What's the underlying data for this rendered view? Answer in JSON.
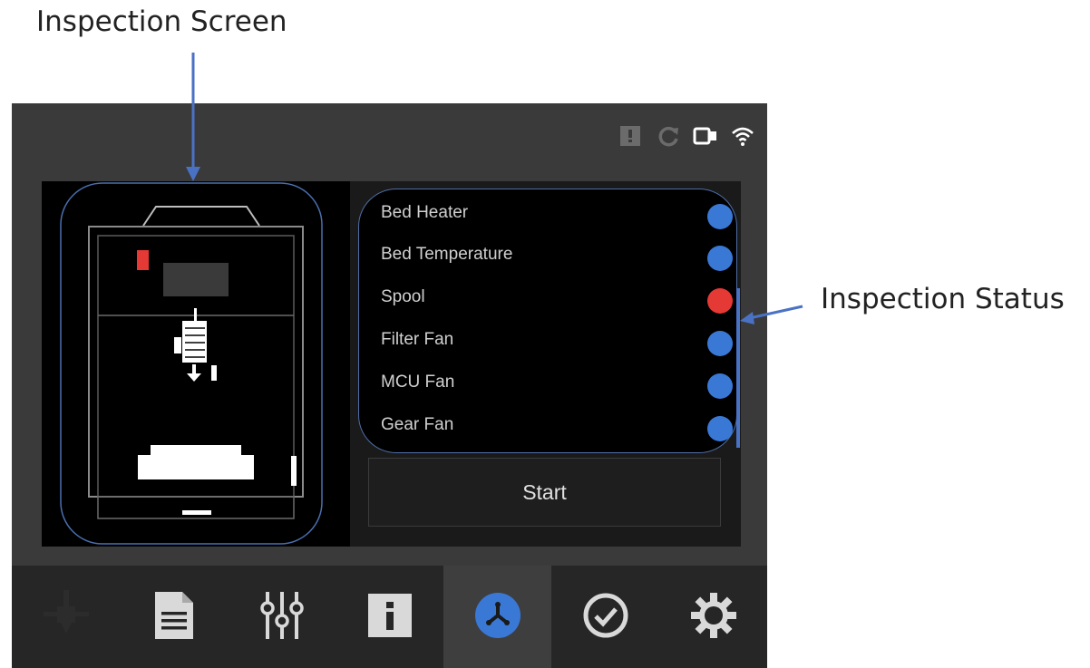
{
  "annotations": {
    "screen_label": "Inspection Screen",
    "status_label": "Inspection Status"
  },
  "status_icons": [
    "warning-icon",
    "refresh-icon",
    "camera-icon",
    "wifi-icon"
  ],
  "inspection_items": [
    {
      "label": "Bed Heater",
      "status_color": "#3a78d6"
    },
    {
      "label": "Bed Temperature",
      "status_color": "#3a78d6"
    },
    {
      "label": "Spool",
      "status_color": "#e53935"
    },
    {
      "label": "Filter Fan",
      "status_color": "#3a78d6"
    },
    {
      "label": "MCU Fan",
      "status_color": "#3a78d6"
    },
    {
      "label": "Gear Fan",
      "status_color": "#3a78d6"
    }
  ],
  "start_button": {
    "label": "Start"
  },
  "tabs": [
    {
      "icon": "nozzle-icon",
      "active": false
    },
    {
      "icon": "document-icon",
      "active": false
    },
    {
      "icon": "sliders-icon",
      "active": false
    },
    {
      "icon": "info-icon",
      "active": false
    },
    {
      "icon": "inspection-icon",
      "active": true
    },
    {
      "icon": "checkmark-icon",
      "active": false
    },
    {
      "icon": "gear-icon",
      "active": false
    }
  ],
  "colors": {
    "status_ok": "#3a78d6",
    "status_error": "#e53935",
    "accent_blue": "#4a72c4"
  }
}
